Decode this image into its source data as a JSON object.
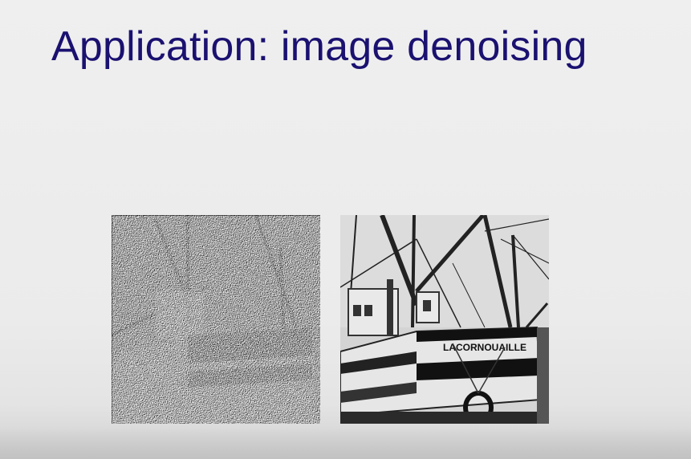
{
  "slide": {
    "title": "Application: image denoising"
  },
  "images": {
    "noisy": {
      "icon": "noisy-boat-image"
    },
    "clean": {
      "icon": "clean-boat-image",
      "boat_name": "LACORNOUAILLE"
    }
  }
}
